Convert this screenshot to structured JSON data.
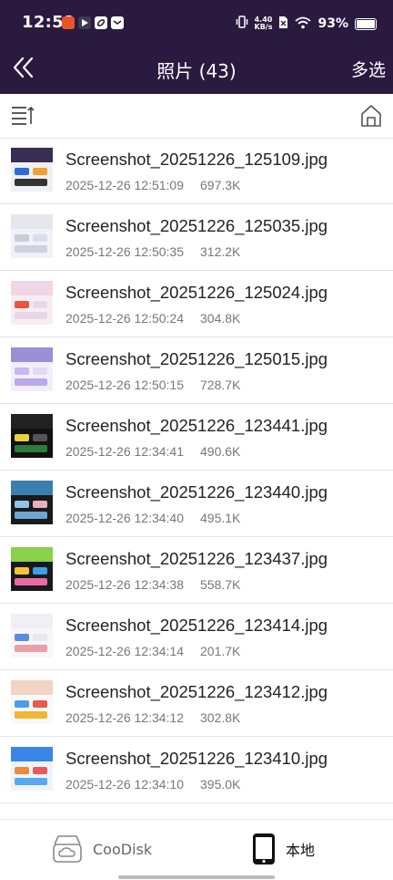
{
  "status_bar": {
    "time": "12:51",
    "net_speed_value": "4.40",
    "net_speed_unit": "KB/s",
    "battery_percent": "93%",
    "battery_level": 0.93
  },
  "header": {
    "title": "照片 (43)",
    "multi_select": "多选"
  },
  "files": [
    {
      "name": "Screenshot_20251226_125109.jpg",
      "date": "2025-12-26 12:51:09",
      "size": "697.3K"
    },
    {
      "name": "Screenshot_20251226_125035.jpg",
      "date": "2025-12-26 12:50:35",
      "size": "312.2K"
    },
    {
      "name": "Screenshot_20251226_125024.jpg",
      "date": "2025-12-26 12:50:24",
      "size": "304.8K"
    },
    {
      "name": "Screenshot_20251226_125015.jpg",
      "date": "2025-12-26 12:50:15",
      "size": "728.7K"
    },
    {
      "name": "Screenshot_20251226_123441.jpg",
      "date": "2025-12-26 12:34:41",
      "size": "490.6K"
    },
    {
      "name": "Screenshot_20251226_123440.jpg",
      "date": "2025-12-26 12:34:40",
      "size": "495.1K"
    },
    {
      "name": "Screenshot_20251226_123437.jpg",
      "date": "2025-12-26 12:34:38",
      "size": "558.7K"
    },
    {
      "name": "Screenshot_20251226_123414.jpg",
      "date": "2025-12-26 12:34:14",
      "size": "201.7K"
    },
    {
      "name": "Screenshot_20251226_123412.jpg",
      "date": "2025-12-26 12:34:12",
      "size": "302.8K"
    },
    {
      "name": "Screenshot_20251226_123410.jpg",
      "date": "2025-12-26 12:34:10",
      "size": "395.0K"
    }
  ],
  "bottom_tabs": [
    {
      "label": "CooDisk",
      "icon": "cloud-disk-icon"
    },
    {
      "label": "本地",
      "icon": "phone-icon"
    }
  ],
  "colors": {
    "header_bg": "#2a1a40",
    "divider": "#e3e3e3"
  }
}
